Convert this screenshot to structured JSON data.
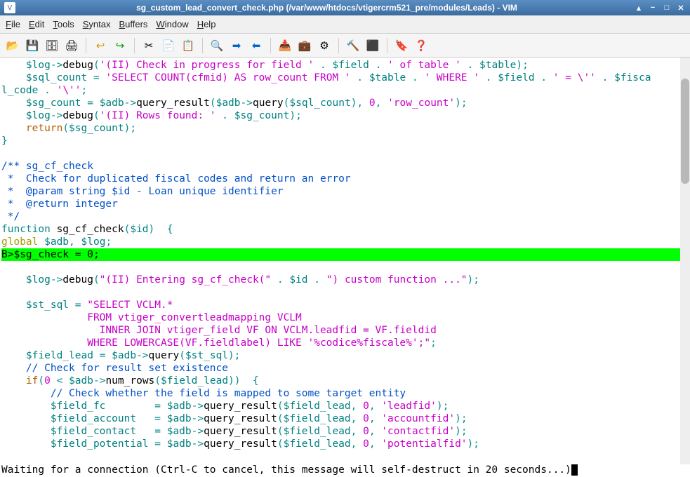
{
  "window": {
    "title": "sg_custom_lead_convert_check.php (/var/www/htdocs/vtigercrm521_pre/modules/Leads) - VIM"
  },
  "menu": {
    "file": "File",
    "edit": "Edit",
    "tools": "Tools",
    "syntax": "Syntax",
    "buffers": "Buffers",
    "window": "Window",
    "help": "Help"
  },
  "toolbar_icons": {
    "open": "📂",
    "save": "💾",
    "saveall": "🗄",
    "print": "🖨",
    "undo": "↩",
    "redo": "↪",
    "cut": "✂",
    "copy": "📄",
    "paste": "📋",
    "find": "🔍",
    "next": "➡",
    "prev": "⬅",
    "load": "📥",
    "savesess": "💼",
    "run": "⚙",
    "make": "🔨",
    "shell": "⬛",
    "tags": "🔖",
    "help": "❓"
  },
  "status": {
    "message": "Waiting for a connection (Ctrl-C to cancel, this message will self-destruct in  20  seconds...)"
  },
  "code": {
    "l1a": "    $log",
    "l1b": "->",
    "l1c": "debug",
    "l1d": "(",
    "l1e": "'(II) Check in progress for field '",
    "l1f": " . ",
    "l1g": "$field",
    "l1h": " . ",
    "l1i": "' of table '",
    "l1j": " . ",
    "l1k": "$table",
    "l1l": ");",
    "l2a": "    $sql_count",
    "l2b": " = ",
    "l2c": "'SELECT COUNT(cfmid) AS row_count FROM '",
    "l2d": " . ",
    "l2e": "$table",
    "l2f": " . ",
    "l2g": "' WHERE '",
    "l2h": " . ",
    "l2i": "$field",
    "l2j": " . ",
    "l2k": "' = \\''",
    "l2l": " . ",
    "l2m": "$fisca",
    "l3a": "l_code",
    "l3b": " . ",
    "l3c": "'\\''",
    "l3d": ";",
    "l4a": "    $sg_count",
    "l4b": " = ",
    "l4c": "$adb",
    "l4d": "->",
    "l4e": "query_result",
    "l4f": "(",
    "l4g": "$adb",
    "l4h": "->",
    "l4i": "query",
    "l4j": "(",
    "l4k": "$sql_count",
    "l4l": ")",
    "l4m": ", ",
    "l4n": "0",
    "l4o": ", ",
    "l4p": "'row_count'",
    "l4q": ")",
    "l4r": ";",
    "l5a": "    $log",
    "l5b": "->",
    "l5c": "debug",
    "l5d": "(",
    "l5e": "'(II) Rows found: '",
    "l5f": " . ",
    "l5g": "$sg_count",
    "l5h": ")",
    "l5i": ";",
    "l6a": "    return",
    "l6b": "(",
    "l6c": "$sg_count",
    "l6d": ")",
    "l6e": ";",
    "l7": "}",
    "l9": "/** sg_cf_check",
    "l10": " *  Check for duplicated fiscal codes and return an error",
    "l11": " *  @param string $id - Loan unique identifier",
    "l12": " *  @return integer",
    "l13": " */",
    "l14a": "function",
    "l14b": " sg_cf_check",
    "l14c": "(",
    "l14d": "$id",
    "l14e": ")",
    "l14f": "  {",
    "l15a": "global",
    "l15b": " $adb",
    "l15c": ", ",
    "l15d": "$log",
    "l15e": ";",
    "bp": "B>",
    "l16": "$sg_check = 0;",
    "l18a": "    $log",
    "l18b": "->",
    "l18c": "debug",
    "l18d": "(",
    "l18e": "\"(II) Entering sg_cf_check(\"",
    "l18f": " . ",
    "l18g": "$id",
    "l18h": " . ",
    "l18i": "\") custom function ...\"",
    "l18j": ")",
    "l18k": ";",
    "l20a": "    $st_sql",
    "l20b": " = ",
    "l20c": "\"SELECT VCLM.*",
    "l21": "              FROM vtiger_convertleadmapping VCLM",
    "l22": "                INNER JOIN vtiger_field VF ON VCLM.leadfid = VF.fieldid",
    "l23": "              WHERE LOWERCASE(VF.fieldlabel) LIKE '%codice%fiscale%';\"",
    "l23b": ";",
    "l24a": "    $field_lead",
    "l24b": " = ",
    "l24c": "$adb",
    "l24d": "->",
    "l24e": "query",
    "l24f": "(",
    "l24g": "$st_sql",
    "l24h": ")",
    "l24i": ";",
    "l25": "    // Check for result set existence",
    "l26a": "    if",
    "l26b": "(",
    "l26c": "0",
    "l26d": " < ",
    "l26e": "$adb",
    "l26f": "->",
    "l26g": "num_rows",
    "l26h": "(",
    "l26i": "$field_lead",
    "l26j": "))",
    "l26k": "  {",
    "l27": "        // Check whether the field is mapped to some target entity",
    "l28a": "        $field_fc",
    "l28b": "        = ",
    "l28c": "$adb",
    "l28d": "->",
    "l28e": "query_result",
    "l28f": "(",
    "l28g": "$field_lead",
    "l28h": ", ",
    "l28i": "0",
    "l28j": ", ",
    "l28k": "'leadfid'",
    "l28l": ")",
    "l28m": ";",
    "l29a": "        $field_account",
    "l29b": "   = ",
    "l29c": "$adb",
    "l29d": "->",
    "l29e": "query_result",
    "l29f": "(",
    "l29g": "$field_lead",
    "l29h": ", ",
    "l29i": "0",
    "l29j": ", ",
    "l29k": "'accountfid'",
    "l29l": ")",
    "l29m": ";",
    "l30a": "        $field_contact",
    "l30b": "   = ",
    "l30c": "$adb",
    "l30d": "->",
    "l30e": "query_result",
    "l30f": "(",
    "l30g": "$field_lead",
    "l30h": ", ",
    "l30i": "0",
    "l30j": ", ",
    "l30k": "'contactfid'",
    "l30l": ")",
    "l30m": ";",
    "l31a": "        $field_potential",
    "l31b": " = ",
    "l31c": "$adb",
    "l31d": "->",
    "l31e": "query_result",
    "l31f": "(",
    "l31g": "$field_lead",
    "l31h": ", ",
    "l31i": "0",
    "l31j": ", ",
    "l31k": "'potentialfid'",
    "l31l": ")",
    "l31m": ";"
  }
}
